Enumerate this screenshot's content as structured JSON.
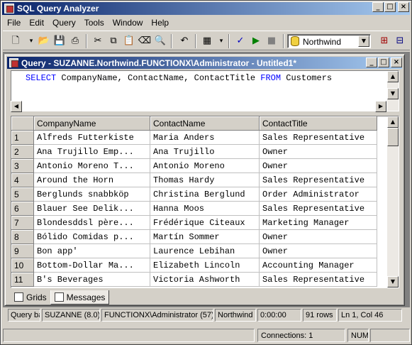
{
  "app": {
    "title": "SQL Query Analyzer",
    "caption_buttons": {
      "minimize": "_",
      "maximize": "□",
      "close": "×"
    }
  },
  "menu": [
    "File",
    "Edit",
    "Query",
    "Tools",
    "Window",
    "Help"
  ],
  "toolbar": {
    "icons": [
      "new-query-icon",
      "open-icon",
      "save-icon",
      "print-icon",
      "cut-icon",
      "copy-icon",
      "paste-icon",
      "clear-window-icon",
      "find-icon",
      "undo-icon",
      "results-grid-icon",
      "parse-query-icon",
      "execute-icon",
      "stop-icon",
      "object-browser-icon",
      "show-plan-icon"
    ],
    "database": "Northwind"
  },
  "query_window": {
    "title": "Query - SUZANNE.Northwind.FUNCTIONX\\Administrator - Untitled1*",
    "sql": {
      "select": "SELECT",
      "columns": " CompanyName, ContactName, ContactTitle ",
      "from": "FROM",
      "table": " Customers"
    }
  },
  "grid": {
    "columns": [
      "CompanyName",
      "ContactName",
      "ContactTitle"
    ],
    "rows": [
      {
        "n": "1",
        "company": "Alfreds Futterkiste",
        "contact": "Maria Anders",
        "title": "Sales Representative"
      },
      {
        "n": "2",
        "company": "Ana Trujillo Emp...",
        "contact": "Ana Trujillo",
        "title": "Owner"
      },
      {
        "n": "3",
        "company": "Antonio Moreno T...",
        "contact": "Antonio Moreno",
        "title": "Owner"
      },
      {
        "n": "4",
        "company": "Around the Horn",
        "contact": "Thomas Hardy",
        "title": "Sales Representative"
      },
      {
        "n": "5",
        "company": "Berglunds snabbköp",
        "contact": "Christina Berglund",
        "title": "Order Administrator"
      },
      {
        "n": "6",
        "company": "Blauer See Delik...",
        "contact": "Hanna Moos",
        "title": "Sales Representative"
      },
      {
        "n": "7",
        "company": "Blondesddsl père...",
        "contact": "Frédérique Citeaux",
        "title": "Marketing Manager"
      },
      {
        "n": "8",
        "company": "Bólido Comidas p...",
        "contact": "Martín Sommer",
        "title": "Owner"
      },
      {
        "n": "9",
        "company": "Bon app'",
        "contact": "Laurence Lebihan",
        "title": "Owner"
      },
      {
        "n": "10",
        "company": "Bottom-Dollar Ma...",
        "contact": "Elizabeth Lincoln",
        "title": "Accounting Manager"
      },
      {
        "n": "11",
        "company": "B's Beverages",
        "contact": "Victoria Ashworth",
        "title": "Sales Representative"
      }
    ]
  },
  "tabs": {
    "grids": "Grids",
    "messages": "Messages"
  },
  "child_status": {
    "state": "Query ba",
    "server": "SUZANNE (8.0)",
    "user": "FUNCTIONX\\Administrator (57)",
    "db": "Northwind",
    "time": "0:00:00",
    "rows": "91 rows",
    "position": "Ln 1, Col 46"
  },
  "main_status": {
    "connections": "Connections: 1",
    "num": "NUM"
  }
}
